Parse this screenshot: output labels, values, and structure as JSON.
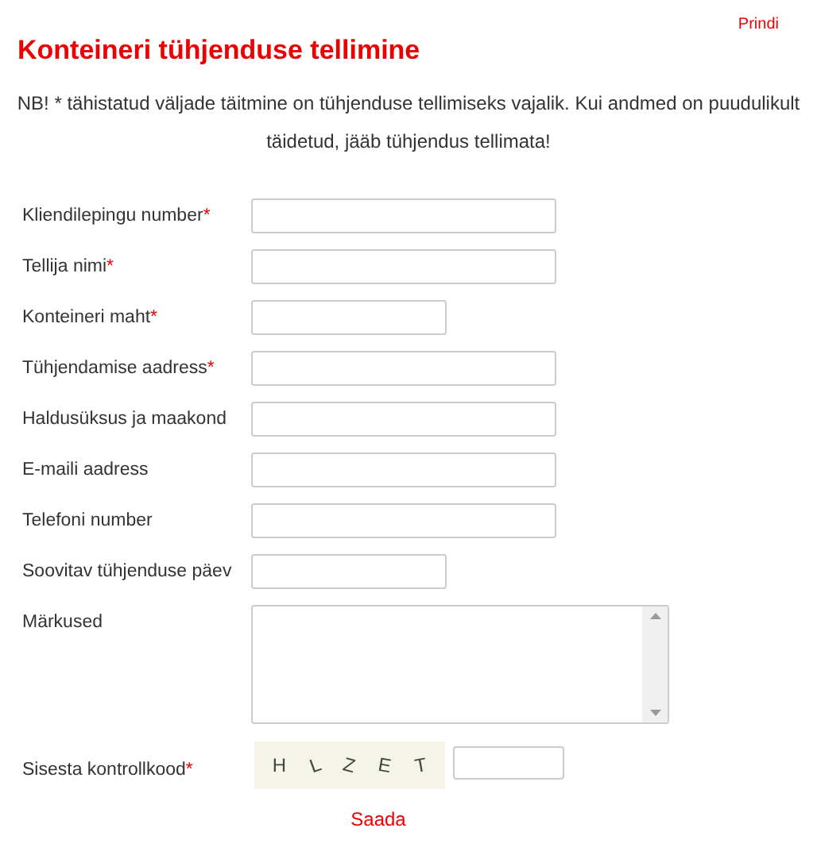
{
  "print_link": "Prindi",
  "title": "Konteineri tühjenduse tellimine",
  "notice": "NB! * tähistatud väljade täitmine on tühjenduse tellimiseks vajalik. Kui andmed on puudulikult täidetud, jääb tühjendus tellimata!",
  "fields": [
    {
      "label": "Kliendilepingu number",
      "required_mark": "*",
      "kind": "wide"
    },
    {
      "label": "Tellija nimi",
      "required_mark": "*",
      "kind": "wide"
    },
    {
      "label": "Konteineri maht",
      "required_mark": "*",
      "kind": "short"
    },
    {
      "label": "Tühjendamise aadress",
      "required_mark": "*",
      "kind": "wide"
    },
    {
      "label": "Haldusüksus ja maakond",
      "kind": "wide"
    },
    {
      "label": "E-maili aadress",
      "kind": "wide"
    },
    {
      "label": "Telefoni number",
      "kind": "wide"
    },
    {
      "label": "Soovitav tühjenduse päev",
      "kind": "short"
    },
    {
      "label": "Märkused",
      "kind": "textarea"
    }
  ],
  "captcha": {
    "label": "Sisesta kontrollkood",
    "required_mark": "*",
    "characters": [
      "H",
      "L",
      "Z",
      "E",
      "T"
    ]
  },
  "submit": "Saada"
}
